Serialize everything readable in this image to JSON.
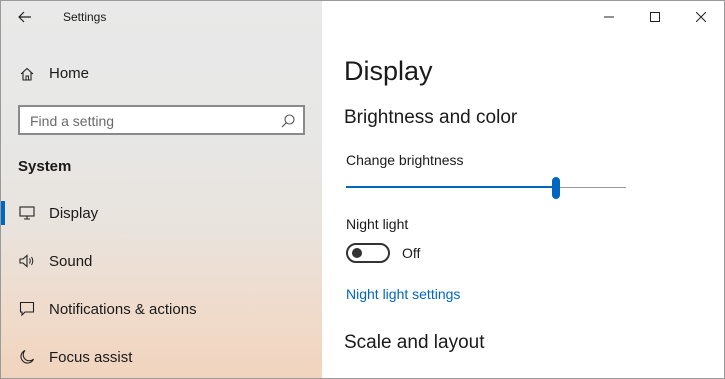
{
  "window": {
    "title": "Settings"
  },
  "sidebar": {
    "home_label": "Home",
    "search": {
      "placeholder": "Find a setting"
    },
    "section_label": "System",
    "items": [
      {
        "label": "Display",
        "icon": "monitor-icon",
        "active": true
      },
      {
        "label": "Sound",
        "icon": "speaker-icon",
        "active": false
      },
      {
        "label": "Notifications & actions",
        "icon": "notification-icon",
        "active": false
      },
      {
        "label": "Focus assist",
        "icon": "moon-icon",
        "active": false
      }
    ]
  },
  "main": {
    "page_title": "Display",
    "brightness_section": {
      "title": "Brightness and color",
      "brightness_label": "Change brightness",
      "brightness_level": 75
    },
    "night_light": {
      "label": "Night light",
      "state": "Off",
      "on": false,
      "settings_link": "Night light settings"
    },
    "scale_section": {
      "title": "Scale and layout"
    }
  },
  "colors": {
    "accent": "#0067c0",
    "text": "#1a1a1a",
    "sidebar_bottom": "#f1d4bd"
  }
}
